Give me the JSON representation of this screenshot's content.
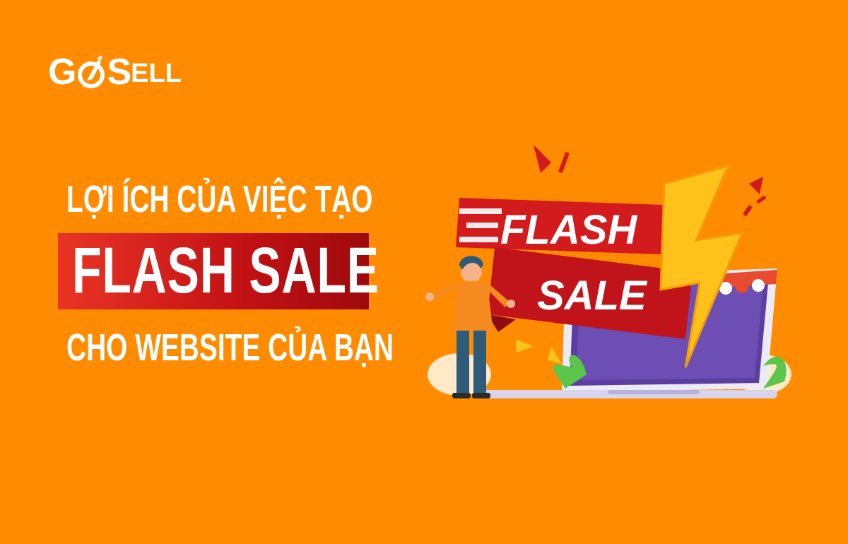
{
  "brand": {
    "logo_prefix": "G",
    "logo_middle": "S",
    "logo_suffix": "ELL"
  },
  "headline": {
    "line1": "LỢI ÍCH CỦA VIỆC TẠO",
    "line2": "FLASH SALE",
    "line3": "CHO WEBSITE CỦA BẠN"
  },
  "illustration": {
    "banner_line1": "FLASH",
    "banner_line2": "SALE"
  },
  "colors": {
    "background": "#FF8C00",
    "accent_red": "#D31A1D",
    "bolt_yellow": "#FFC21A",
    "screen_purple": "#5B3FA0"
  }
}
